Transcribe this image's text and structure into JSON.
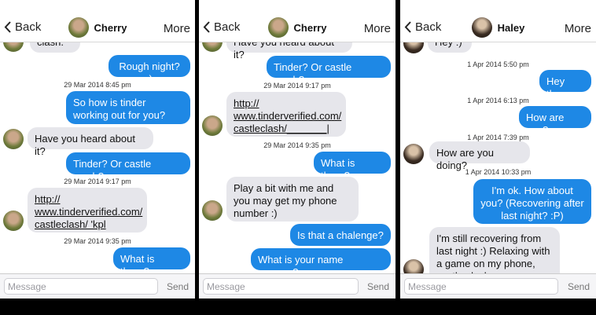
{
  "panels": [
    {
      "back": "Back",
      "contact": "Cherry",
      "more": "More",
      "placeholder": "Message",
      "send": "Send",
      "messages": [
        {
          "text": "clash."
        },
        {
          "text": "Rough night? :)"
        },
        {
          "ts": "29 Mar 2014 8:45 pm"
        },
        {
          "text": "So how is tinder working out for you?"
        },
        {
          "text": "Have you heard about it?"
        },
        {
          "text": "Tinder? Or castle crash?"
        },
        {
          "ts": "29 Mar 2014 9:17 pm"
        },
        {
          "text": "http:// www.tinderverified.com/ castleclash/       'kpl"
        },
        {
          "ts": "29 Mar 2014 9:35 pm"
        },
        {
          "text": "What is there?"
        }
      ]
    },
    {
      "back": "Back",
      "contact": "Cherry",
      "more": "More",
      "placeholder": "Message",
      "send": "Send",
      "messages": [
        {
          "text": "Have you heard about it?"
        },
        {
          "text": "Tinder? Or castle crash?"
        },
        {
          "ts": "29 Mar 2014 9:17 pm"
        },
        {
          "text": "http:// www.tinderverified.com/ castleclash/_______|"
        },
        {
          "ts": "29 Mar 2014 9:35 pm"
        },
        {
          "text": "What is there?"
        },
        {
          "text": "Play a bit with me and you may get my phone number :)"
        },
        {
          "text": "Is that a chalenge?"
        },
        {
          "text": "What is your name anyway?"
        }
      ]
    },
    {
      "back": "Back",
      "contact": "Haley",
      "more": "More",
      "placeholder": "Message",
      "send": "Send",
      "messages": [
        {
          "text": "Hey :)"
        },
        {
          "ts": "1 Apr 2014 5:50 pm"
        },
        {
          "text": "Hey there"
        },
        {
          "ts": "1 Apr 2014 6:13 pm"
        },
        {
          "text": "How are you?"
        },
        {
          "ts": "1 Apr 2014 7:39 pm"
        },
        {
          "text": "How are you doing?"
        },
        {
          "ts": "1 Apr 2014 10:33 pm"
        },
        {
          "text": "I'm ok. How about you? (Recovering after last night? :P)"
        },
        {
          "text": "I'm still recovering from last night :) Relaxing with a game on my phone, castle clash."
        }
      ]
    }
  ],
  "colors": {
    "outgoing": "#1e88e5",
    "incoming": "#e6e6eb"
  }
}
